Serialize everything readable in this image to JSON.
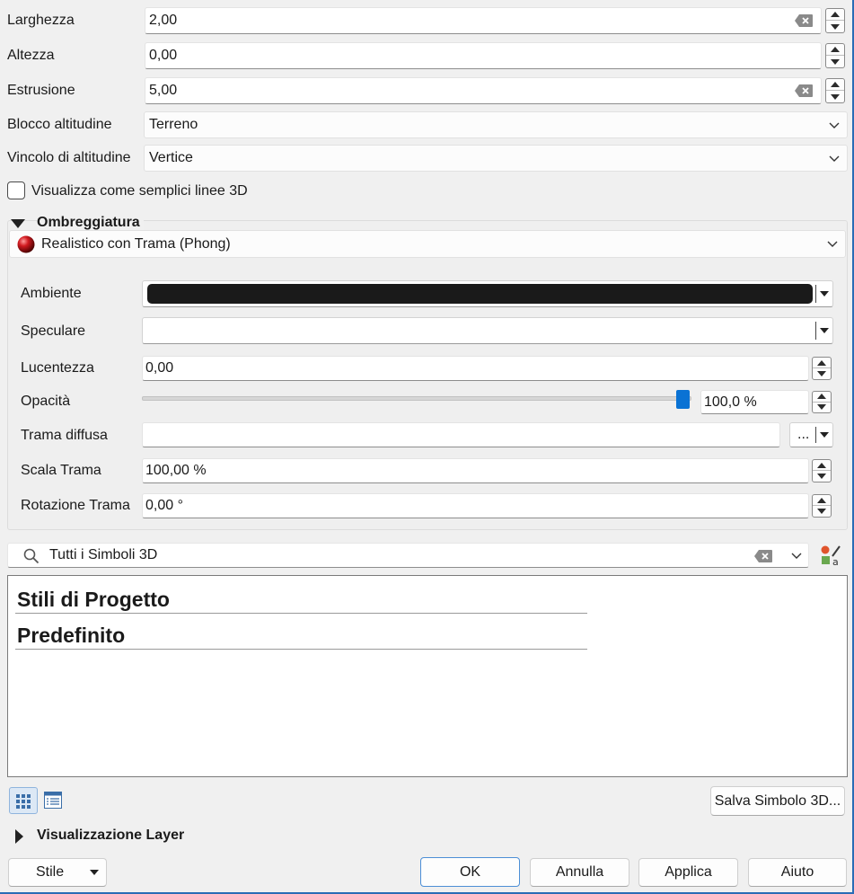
{
  "fields": {
    "larghezza": {
      "label": "Larghezza",
      "value": "2,00"
    },
    "altezza": {
      "label": "Altezza",
      "value": "0,00"
    },
    "estrusione": {
      "label": "Estrusione",
      "value": "5,00"
    },
    "blocco_altitudine": {
      "label": "Blocco altitudine",
      "value": "Terreno"
    },
    "vincolo_altitudine": {
      "label": "Vincolo di altitudine",
      "value": "Vertice"
    },
    "simple_lines": {
      "label": "Visualizza come semplici linee 3D",
      "checked": false
    }
  },
  "shading": {
    "title": "Ombreggiatura",
    "mode": "Realistico con Trama (Phong)",
    "ambient": {
      "label": "Ambiente",
      "color": "#1a1a1a"
    },
    "specular": {
      "label": "Speculare",
      "color": "#ffffff"
    },
    "shininess": {
      "label": "Lucentezza",
      "value": "0,00"
    },
    "opacity": {
      "label": "Opacità",
      "value": "100,0 %",
      "level": 1.0
    },
    "diffuse": {
      "label": "Trama diffusa",
      "value": "",
      "browse": "..."
    },
    "tex_scale": {
      "label": "Scala Trama",
      "value": "100,00 %"
    },
    "tex_rotation": {
      "label": "Rotazione Trama",
      "value": "0,00 °"
    }
  },
  "library": {
    "filter": "Tutti i Simboli 3D",
    "groups": [
      "Stili di Progetto",
      "Predefinito"
    ],
    "save_button": "Salva Simbolo 3D..."
  },
  "layer_rendering": {
    "title": "Visualizzazione Layer"
  },
  "footer": {
    "style": "Stile",
    "ok": "OK",
    "cancel": "Annulla",
    "apply": "Applica",
    "help": "Aiuto"
  },
  "colors": {
    "accent": "#0a72d4",
    "sphere": "#c2131a"
  }
}
